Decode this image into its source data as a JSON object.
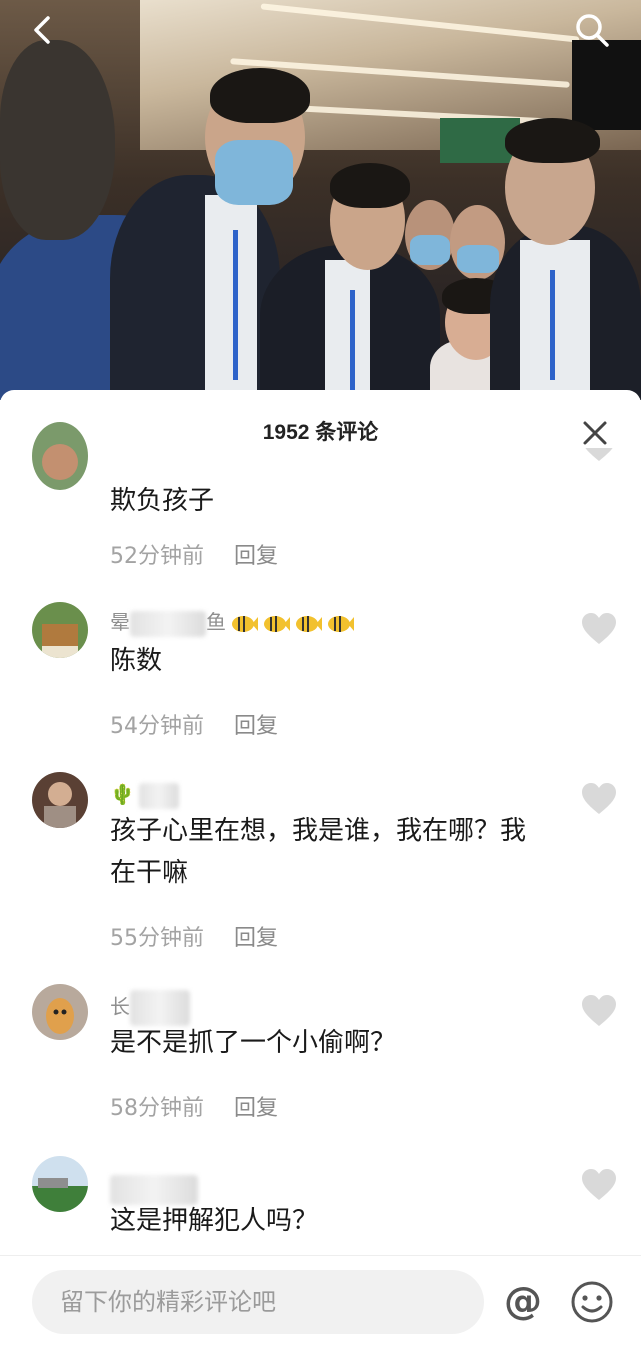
{
  "sheet": {
    "title": "1952 条评论"
  },
  "comments": [
    {
      "username": "",
      "text": "欺负孩子",
      "time": "52分钟前",
      "reply": "回复"
    },
    {
      "username": "晕",
      "username_tail": "鱼",
      "text": "陈数",
      "time": "54分钟前",
      "reply": "回复"
    },
    {
      "username": "🌵",
      "text": "孩子心里在想，我是谁，我在哪？我在干嘛",
      "time": "55分钟前",
      "reply": "回复"
    },
    {
      "username": "长",
      "text": "是不是抓了一个小偷啊？",
      "time": "58分钟前",
      "reply": "回复"
    },
    {
      "username": "",
      "text": "这是押解犯人吗？",
      "time": "",
      "reply": ""
    }
  ],
  "input": {
    "placeholder": "留下你的精彩评论吧"
  },
  "icons": {
    "back": "chevron-left-icon",
    "search": "search-icon",
    "close": "close-icon",
    "like": "heart-icon",
    "mention": "at-icon",
    "emoji": "smile-icon"
  },
  "colors": {
    "heart": "#d9d9d9",
    "muted_text": "#a3a3a3",
    "input_bg": "#f1f1f1"
  }
}
